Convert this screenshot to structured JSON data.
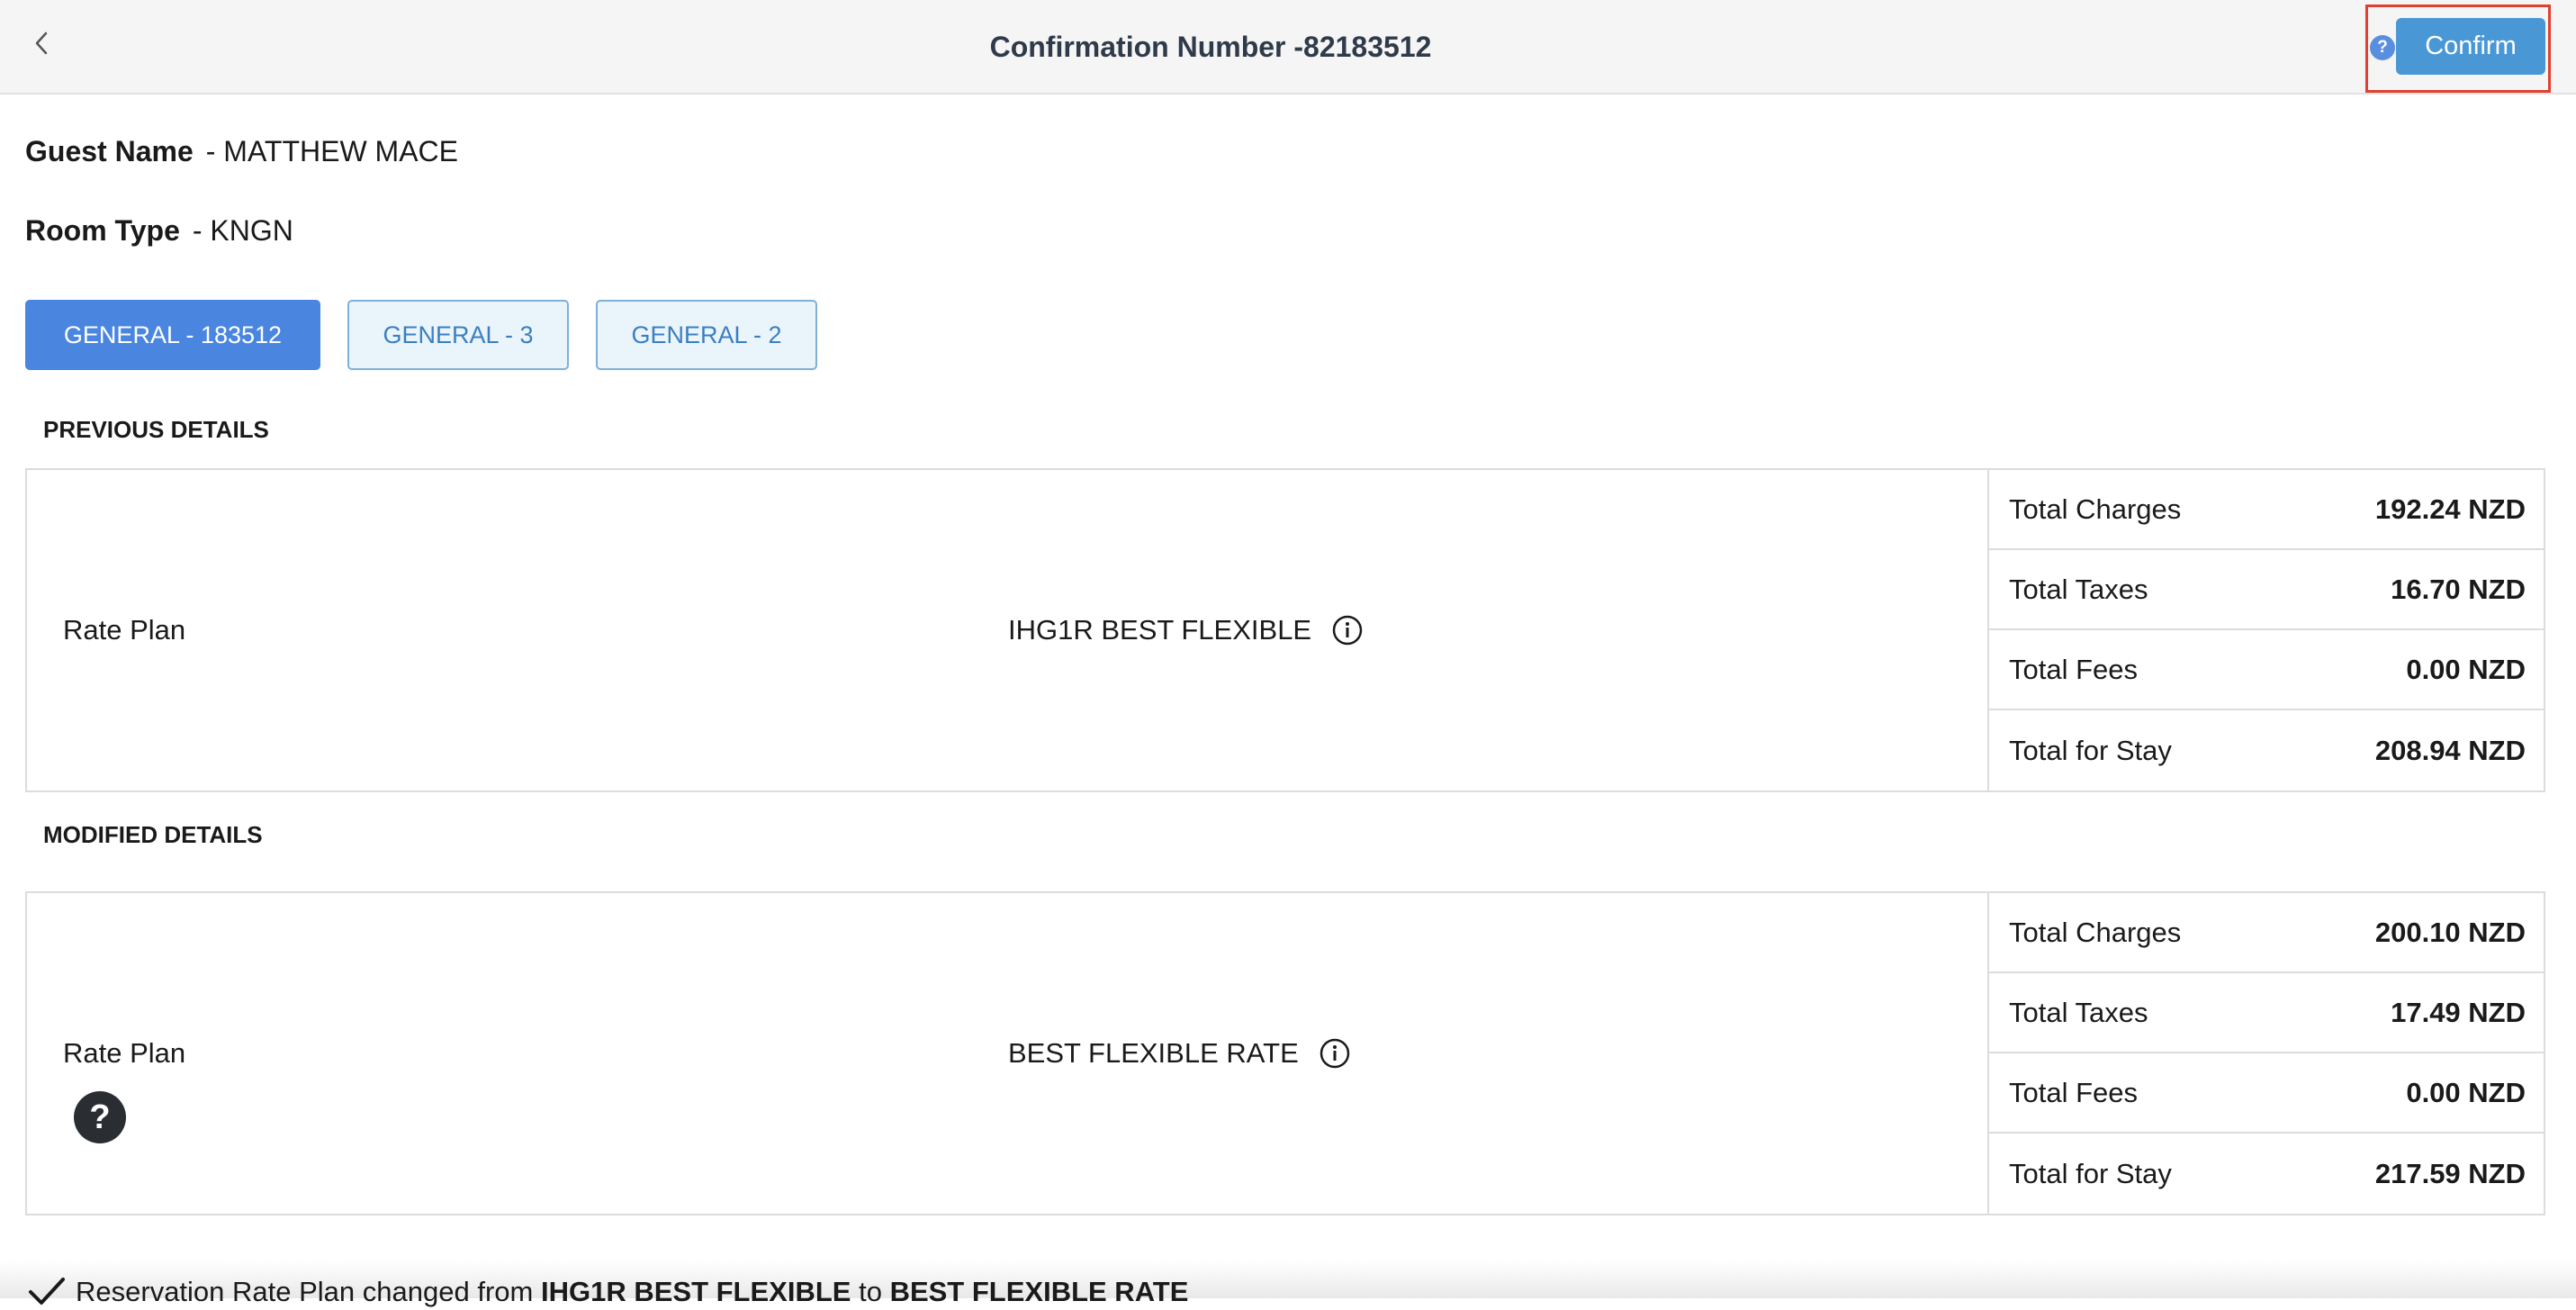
{
  "header": {
    "title": "Confirmation Number -82183512",
    "confirm_label": "Confirm",
    "help_glyph": "?"
  },
  "guest": {
    "label": "Guest Name",
    "value": "- MATTHEW MACE"
  },
  "room": {
    "label": "Room Type",
    "value": "- KNGN"
  },
  "tabs": [
    {
      "label": "GENERAL - 183512",
      "active": true
    },
    {
      "label": "GENERAL - 3",
      "active": false
    },
    {
      "label": "GENERAL - 2",
      "active": false
    }
  ],
  "previous": {
    "title": "PREVIOUS DETAILS",
    "rate_label": "Rate Plan",
    "rate_value": "IHG1R BEST FLEXIBLE",
    "totals": [
      {
        "label": "Total Charges",
        "value": "192.24 NZD"
      },
      {
        "label": "Total Taxes",
        "value": "16.70 NZD"
      },
      {
        "label": "Total Fees",
        "value": "0.00 NZD"
      },
      {
        "label": "Total for Stay",
        "value": "208.94 NZD"
      }
    ]
  },
  "modified": {
    "title": "MODIFIED DETAILS",
    "rate_label": "Rate Plan",
    "rate_value": "BEST FLEXIBLE RATE",
    "help_glyph": "?",
    "totals": [
      {
        "label": "Total Charges",
        "value": "200.10 NZD"
      },
      {
        "label": "Total Taxes",
        "value": "17.49 NZD"
      },
      {
        "label": "Total Fees",
        "value": "0.00 NZD"
      },
      {
        "label": "Total for Stay",
        "value": "217.59 NZD"
      }
    ]
  },
  "footer": {
    "msg_prefix": "Reservation Rate Plan changed from",
    "msg_from": "IHG1R BEST FLEXIBLE",
    "msg_to_word": "to",
    "msg_to": "BEST FLEXIBLE RATE"
  },
  "colors": {
    "primary": "#4a97d6",
    "tab_active": "#4a86e0",
    "highlight_border": "#e0402f"
  }
}
